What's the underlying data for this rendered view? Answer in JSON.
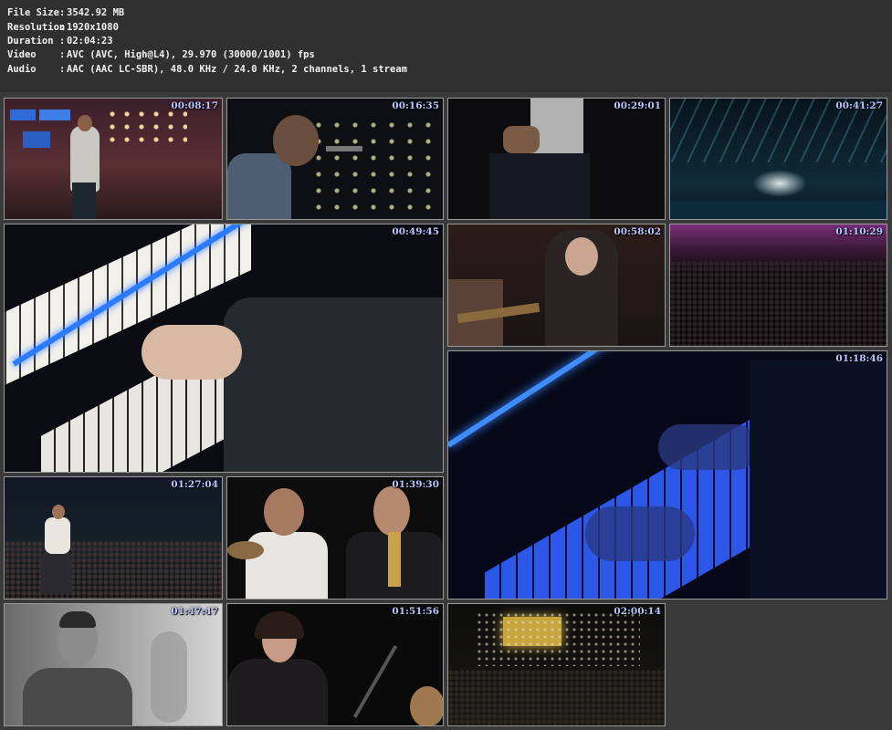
{
  "info": [
    {
      "key": "File Size",
      "value": "3542.92 MB"
    },
    {
      "key": "Resolution",
      "value": "1920x1080"
    },
    {
      "key": "Duration",
      "value": "02:04:23"
    },
    {
      "key": "Video",
      "value": "AVC (AVC, High@L4), 29.970 (30000/1001) fps"
    },
    {
      "key": "Audio",
      "value": "AAC (AAC LC-SBR), 48.0 KHz / 24.0 KHz, 2 channels, 1 stream"
    }
  ],
  "separator": ":",
  "thumbnails": [
    {
      "time": "00:08:17"
    },
    {
      "time": "00:16:35"
    },
    {
      "time": "00:29:01"
    },
    {
      "time": "00:41:27"
    },
    {
      "time": "00:49:45"
    },
    {
      "time": "00:58:02"
    },
    {
      "time": "01:10:29"
    },
    {
      "time": "01:18:46"
    },
    {
      "time": "01:27:04"
    },
    {
      "time": "01:39:30"
    },
    {
      "time": "01:47:47"
    },
    {
      "time": "01:51:56"
    },
    {
      "time": "02:00:14"
    }
  ]
}
